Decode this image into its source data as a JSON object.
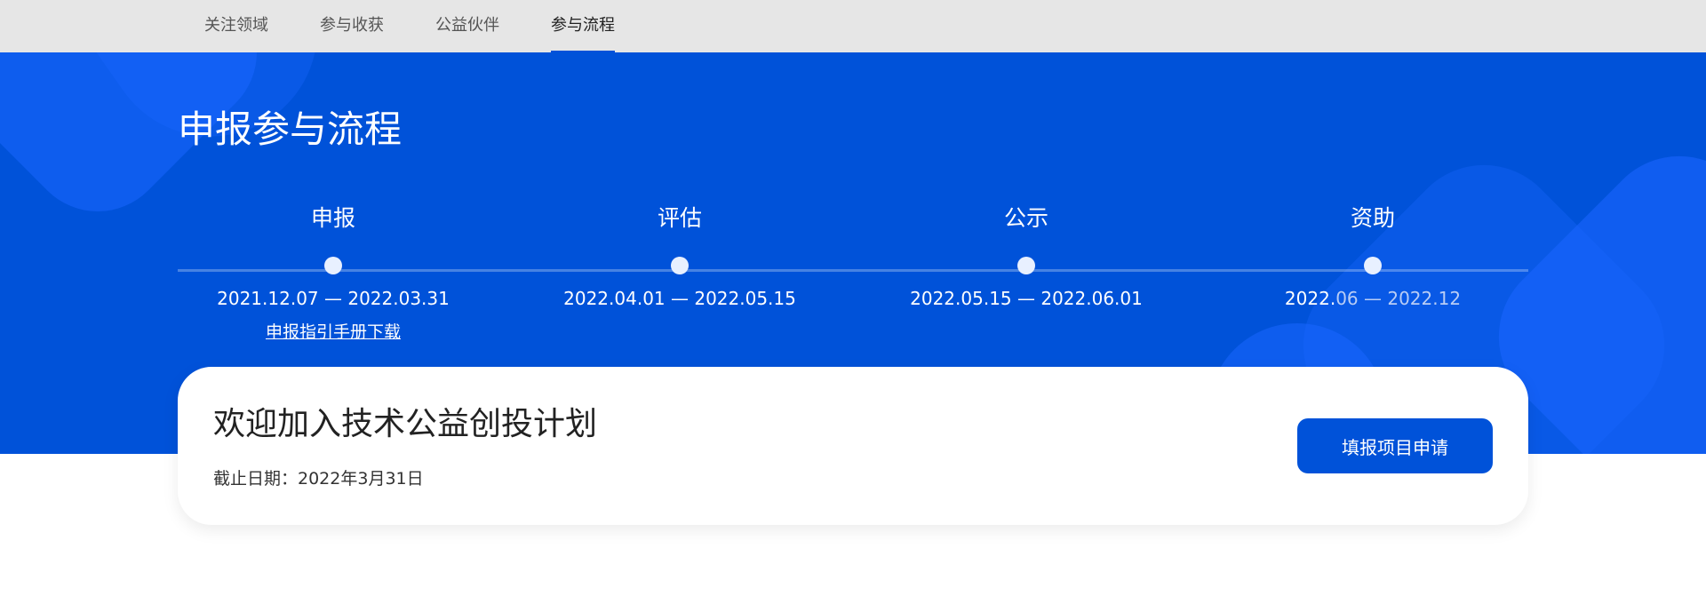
{
  "nav": {
    "tabs": [
      {
        "label": "关注领域"
      },
      {
        "label": "参与收获"
      },
      {
        "label": "公益伙伴"
      },
      {
        "label": "参与流程"
      }
    ],
    "active_index": 3
  },
  "hero": {
    "title": "申报参与流程",
    "steps": [
      {
        "label": "申报",
        "date": "2021.12.07 — 2022.03.31",
        "link": "申报指引手册下载"
      },
      {
        "label": "评估",
        "date": "2022.04.01 — 2022.05.15"
      },
      {
        "label": "公示",
        "date": "2022.05.15 — 2022.06.01"
      },
      {
        "label": "资助",
        "date_part1": "2022.",
        "date_part2": "06 — 2022.12"
      }
    ]
  },
  "card": {
    "title": "欢迎加入技术公益创投计划",
    "deadline": "截止日期：2022年3月31日",
    "button_label": "填报项目申请"
  },
  "colors": {
    "brand_blue": "#0052d9",
    "nav_bg": "#e6e6e6",
    "decor_blue": "#1a66ff"
  }
}
